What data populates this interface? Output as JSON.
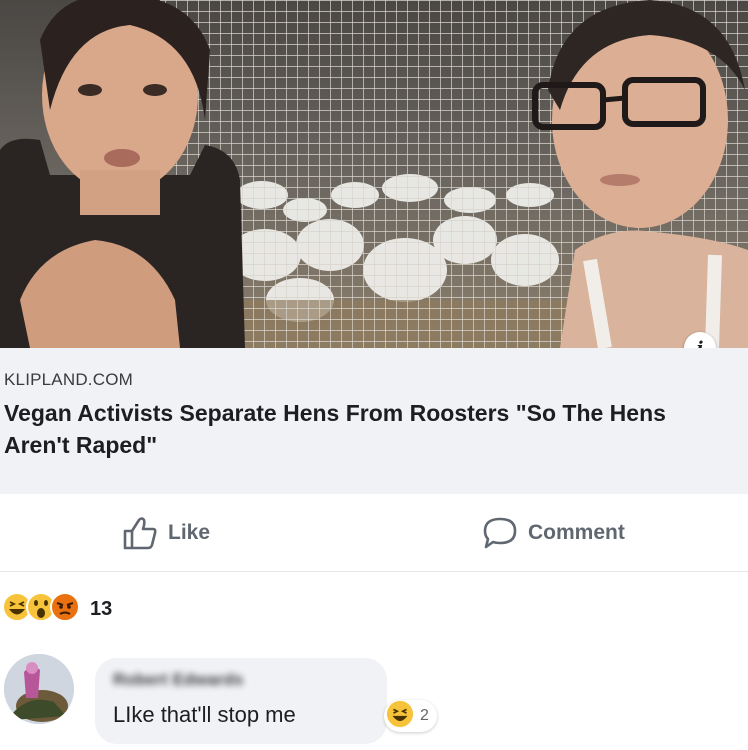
{
  "link_preview": {
    "info_icon": "info-icon",
    "domain": "KLIPLAND.COM",
    "title": "Vegan Activists Separate Hens From Roosters \"So The Hens Aren't Raped\""
  },
  "actions": {
    "like_label": "Like",
    "like_icon": "thumbs-up-icon",
    "comment_label": "Comment",
    "comment_icon": "speech-bubble-icon"
  },
  "reactions": {
    "icons": [
      "haha-icon",
      "wow-icon",
      "angry-icon"
    ],
    "count": "13"
  },
  "comment": {
    "author": "Robert Edwards",
    "text": "LIke that'll stop me",
    "reaction_icon": "haha-icon",
    "reaction_count": "2"
  },
  "colors": {
    "meta_background": "#f0f2f5",
    "action_text": "#606770",
    "haha_yellow": "#f7c33b",
    "angry_orange": "#e9710f"
  }
}
